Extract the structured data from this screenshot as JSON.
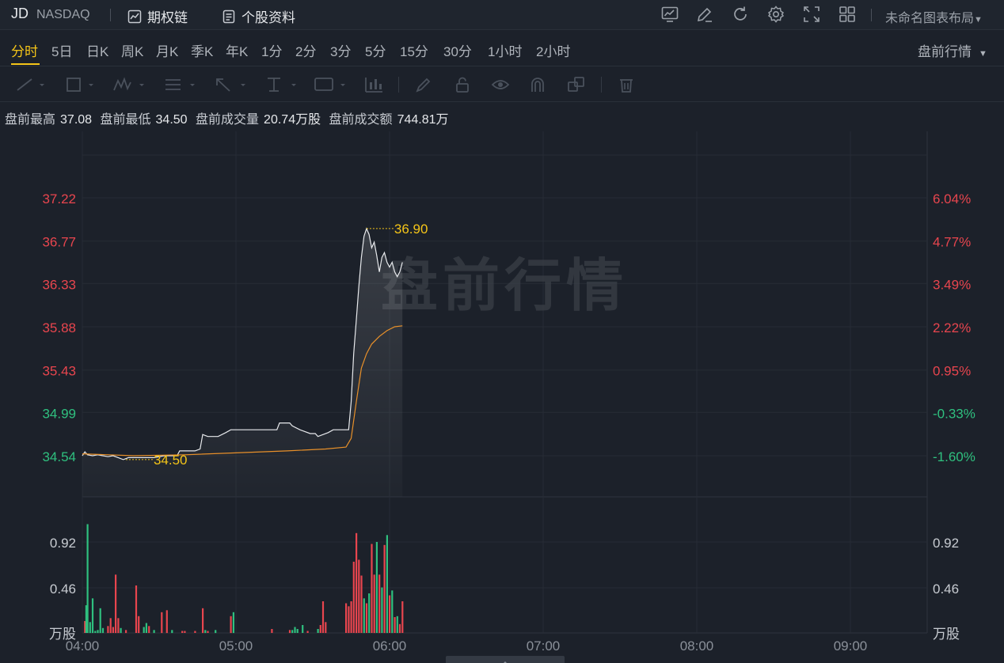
{
  "header": {
    "ticker": "JD",
    "exchange": "NASDAQ",
    "options_chain_label": "期权链",
    "profile_label": "个股资料",
    "layout_name": "未命名图表布局",
    "icons": [
      "chart-icon",
      "pencil-icon",
      "refresh-icon",
      "settings-icon",
      "fullscreen-icon",
      "grid-layout-icon"
    ]
  },
  "periods": [
    "分时",
    "5日",
    "日K",
    "周K",
    "月K",
    "季K",
    "年K",
    "1分",
    "2分",
    "3分",
    "5分",
    "15分",
    "30分",
    "1小时",
    "2小时"
  ],
  "active_period": "分时",
  "session": {
    "label": "盘前行情"
  },
  "stats": {
    "high_label": "盘前最高",
    "high": "37.08",
    "low_label": "盘前最低",
    "low": "34.50",
    "vol_label": "盘前成交量",
    "vol": "20.74万股",
    "amt_label": "盘前成交额",
    "amt": "744.81万"
  },
  "chart_data": {
    "type": "line",
    "watermark": "盘前行情",
    "price_ticks": [
      "37.22",
      "36.77",
      "36.33",
      "35.88",
      "35.43",
      "34.99",
      "34.54"
    ],
    "price_tick_values": [
      37.22,
      36.77,
      36.33,
      35.88,
      35.43,
      34.99,
      34.54
    ],
    "pct_ticks": [
      "6.04%",
      "4.77%",
      "3.49%",
      "2.22%",
      "0.95%",
      "-0.33%",
      "-1.60%"
    ],
    "volume_ticks": [
      "0.92",
      "0.46"
    ],
    "volume_unit": "万股",
    "time_labels": [
      "04:00",
      "05:00",
      "06:00",
      "07:00",
      "08:00",
      "09:00"
    ],
    "x_range_minutes": [
      0,
      330
    ],
    "price_range": [
      34.54,
      37.22
    ],
    "volume_max": 1.38,
    "high_marker": {
      "minute": 111,
      "price": 36.9,
      "label": "36.90"
    },
    "low_marker": {
      "minute": 17,
      "price": 34.5,
      "label": "34.50"
    },
    "colors": {
      "up": "#e8454e",
      "down": "#2fc07f",
      "price_line": "#e8eaed",
      "avg_line": "#e8902a",
      "marker_text": "#f5c518"
    },
    "price_series": [
      [
        0,
        34.54
      ],
      [
        1,
        34.58
      ],
      [
        2,
        34.55
      ],
      [
        4,
        34.54
      ],
      [
        6,
        34.55
      ],
      [
        8,
        34.54
      ],
      [
        10,
        34.53
      ],
      [
        12,
        34.54
      ],
      [
        14,
        34.52
      ],
      [
        16,
        34.5
      ],
      [
        18,
        34.52
      ],
      [
        20,
        34.52
      ],
      [
        24,
        34.52
      ],
      [
        28,
        34.52
      ],
      [
        32,
        34.54
      ],
      [
        37,
        34.54
      ],
      [
        38,
        34.59
      ],
      [
        44,
        34.59
      ],
      [
        46,
        34.61
      ],
      [
        47,
        34.76
      ],
      [
        49,
        34.74
      ],
      [
        53,
        34.74
      ],
      [
        56,
        34.78
      ],
      [
        58,
        34.81
      ],
      [
        63,
        34.81
      ],
      [
        70,
        34.81
      ],
      [
        74,
        34.81
      ],
      [
        76,
        34.81
      ],
      [
        77,
        34.88
      ],
      [
        81,
        34.88
      ],
      [
        82,
        34.85
      ],
      [
        85,
        34.81
      ],
      [
        89,
        34.77
      ],
      [
        91,
        34.77
      ],
      [
        92,
        34.74
      ],
      [
        96,
        34.78
      ],
      [
        98,
        34.81
      ],
      [
        104,
        34.81
      ],
      [
        105,
        35.1
      ],
      [
        106,
        35.6
      ],
      [
        107,
        35.95
      ],
      [
        108,
        36.3
      ],
      [
        109,
        36.6
      ],
      [
        110,
        36.82
      ],
      [
        111,
        36.9
      ],
      [
        112,
        36.84
      ],
      [
        113,
        36.7
      ],
      [
        114,
        36.76
      ],
      [
        115,
        36.62
      ],
      [
        116,
        36.45
      ],
      [
        117,
        36.6
      ],
      [
        118,
        36.65
      ],
      [
        119,
        36.55
      ],
      [
        120,
        36.5
      ],
      [
        121,
        36.55
      ],
      [
        122,
        36.45
      ],
      [
        123,
        36.4
      ],
      [
        124,
        36.45
      ],
      [
        125,
        36.55
      ]
    ],
    "avg_series": [
      [
        0,
        34.56
      ],
      [
        20,
        34.54
      ],
      [
        40,
        34.55
      ],
      [
        60,
        34.57
      ],
      [
        80,
        34.59
      ],
      [
        95,
        34.61
      ],
      [
        103,
        34.63
      ],
      [
        105,
        34.72
      ],
      [
        107,
        35.1
      ],
      [
        109,
        35.45
      ],
      [
        111,
        35.6
      ],
      [
        113,
        35.7
      ],
      [
        116,
        35.78
      ],
      [
        119,
        35.84
      ],
      [
        122,
        35.88
      ],
      [
        125,
        35.89
      ]
    ],
    "volume_series": [
      [
        1,
        0.12,
        "u"
      ],
      [
        1.5,
        0.28,
        "d"
      ],
      [
        2,
        1.1,
        "d"
      ],
      [
        3,
        0.11,
        "d"
      ],
      [
        4,
        0.35,
        "d"
      ],
      [
        5,
        0.02,
        "d"
      ],
      [
        6,
        0.03,
        "d"
      ],
      [
        7,
        0.25,
        "d"
      ],
      [
        8,
        0.05,
        "d"
      ],
      [
        10,
        0.07,
        "u"
      ],
      [
        11,
        0.15,
        "u"
      ],
      [
        12,
        0.06,
        "u"
      ],
      [
        13,
        0.59,
        "u"
      ],
      [
        14,
        0.15,
        "u"
      ],
      [
        15,
        0.05,
        "d"
      ],
      [
        17,
        0.03,
        "u"
      ],
      [
        21,
        0.48,
        "u"
      ],
      [
        22,
        0.17,
        "u"
      ],
      [
        24,
        0.06,
        "d"
      ],
      [
        25,
        0.1,
        "d"
      ],
      [
        26,
        0.07,
        "u"
      ],
      [
        28,
        0.03,
        "d"
      ],
      [
        31,
        0.21,
        "u"
      ],
      [
        33,
        0.23,
        "u"
      ],
      [
        35,
        0.03,
        "d"
      ],
      [
        39,
        0.02,
        "u"
      ],
      [
        40,
        0.02,
        "u"
      ],
      [
        44,
        0.02,
        "u"
      ],
      [
        47,
        0.25,
        "u"
      ],
      [
        48,
        0.03,
        "d"
      ],
      [
        49,
        0.02,
        "u"
      ],
      [
        52,
        0.03,
        "d"
      ],
      [
        58,
        0.17,
        "u"
      ],
      [
        59,
        0.21,
        "d"
      ],
      [
        74,
        0.04,
        "u"
      ],
      [
        81,
        0.03,
        "u"
      ],
      [
        82,
        0.03,
        "d"
      ],
      [
        83,
        0.06,
        "d"
      ],
      [
        84,
        0.04,
        "d"
      ],
      [
        86,
        0.08,
        "d"
      ],
      [
        88,
        0.02,
        "u"
      ],
      [
        92,
        0.04,
        "d"
      ],
      [
        93,
        0.08,
        "u"
      ],
      [
        94,
        0.32,
        "u"
      ],
      [
        95,
        0.11,
        "u"
      ],
      [
        103,
        0.3,
        "u"
      ],
      [
        104,
        0.27,
        "u"
      ],
      [
        105,
        0.32,
        "u"
      ],
      [
        106,
        0.72,
        "u"
      ],
      [
        107,
        1.01,
        "u"
      ],
      [
        108,
        0.74,
        "u"
      ],
      [
        109,
        0.58,
        "u"
      ],
      [
        110,
        0.35,
        "d"
      ],
      [
        111,
        0.3,
        "u"
      ],
      [
        112,
        0.4,
        "d"
      ],
      [
        113,
        0.9,
        "u"
      ],
      [
        114,
        0.59,
        "u"
      ],
      [
        115,
        0.92,
        "d"
      ],
      [
        116,
        0.59,
        "u"
      ],
      [
        117,
        0.46,
        "d"
      ],
      [
        118,
        0.89,
        "u"
      ],
      [
        119,
        0.99,
        "d"
      ],
      [
        120,
        0.38,
        "u"
      ],
      [
        121,
        0.43,
        "d"
      ],
      [
        122,
        0.16,
        "u"
      ],
      [
        123,
        0.17,
        "d"
      ],
      [
        124,
        0.09,
        "u"
      ],
      [
        125,
        0.32,
        "u"
      ]
    ]
  }
}
